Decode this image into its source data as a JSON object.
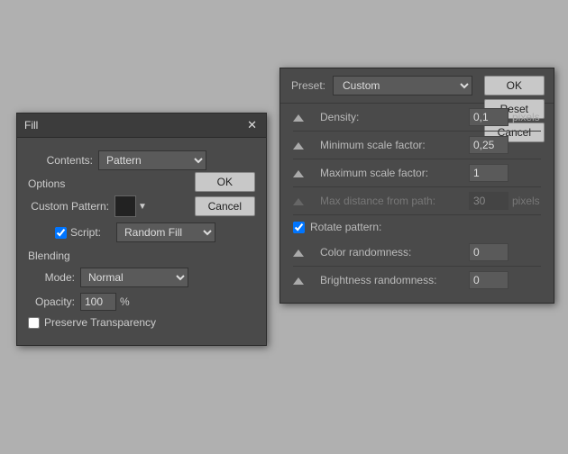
{
  "fill_dialog": {
    "title": "Fill",
    "contents_label": "Contents:",
    "contents_value": "Pattern",
    "ok_label": "OK",
    "cancel_label": "Cancel",
    "options_label": "Options",
    "custom_pattern_label": "Custom Pattern:",
    "script_label": "Script:",
    "script_checked": true,
    "script_value": "Random Fill",
    "blending_label": "Blending",
    "mode_label": "Mode:",
    "mode_value": "Normal",
    "opacity_label": "Opacity:",
    "opacity_value": "100",
    "opacity_unit": "%",
    "preserve_label": "Preserve Transparency",
    "preserve_checked": false
  },
  "script_panel": {
    "preset_label": "Preset:",
    "preset_value": "Custom",
    "ok_label": "OK",
    "reset_label": "Reset",
    "cancel_label": "Cancel",
    "density_label": "Density:",
    "density_value": "0,1",
    "density_unit": "pixels",
    "min_scale_label": "Minimum scale factor:",
    "min_scale_value": "0,25",
    "max_scale_label": "Maximum scale factor:",
    "max_scale_value": "1",
    "max_dist_label": "Max distance from path:",
    "max_dist_value": "30",
    "max_dist_unit": "pixels",
    "max_dist_disabled": true,
    "rotate_label": "Rotate pattern:",
    "rotate_checked": true,
    "color_rand_label": "Color randomness:",
    "color_rand_value": "0",
    "brightness_rand_label": "Brightness randomness:",
    "brightness_rand_value": "0"
  }
}
